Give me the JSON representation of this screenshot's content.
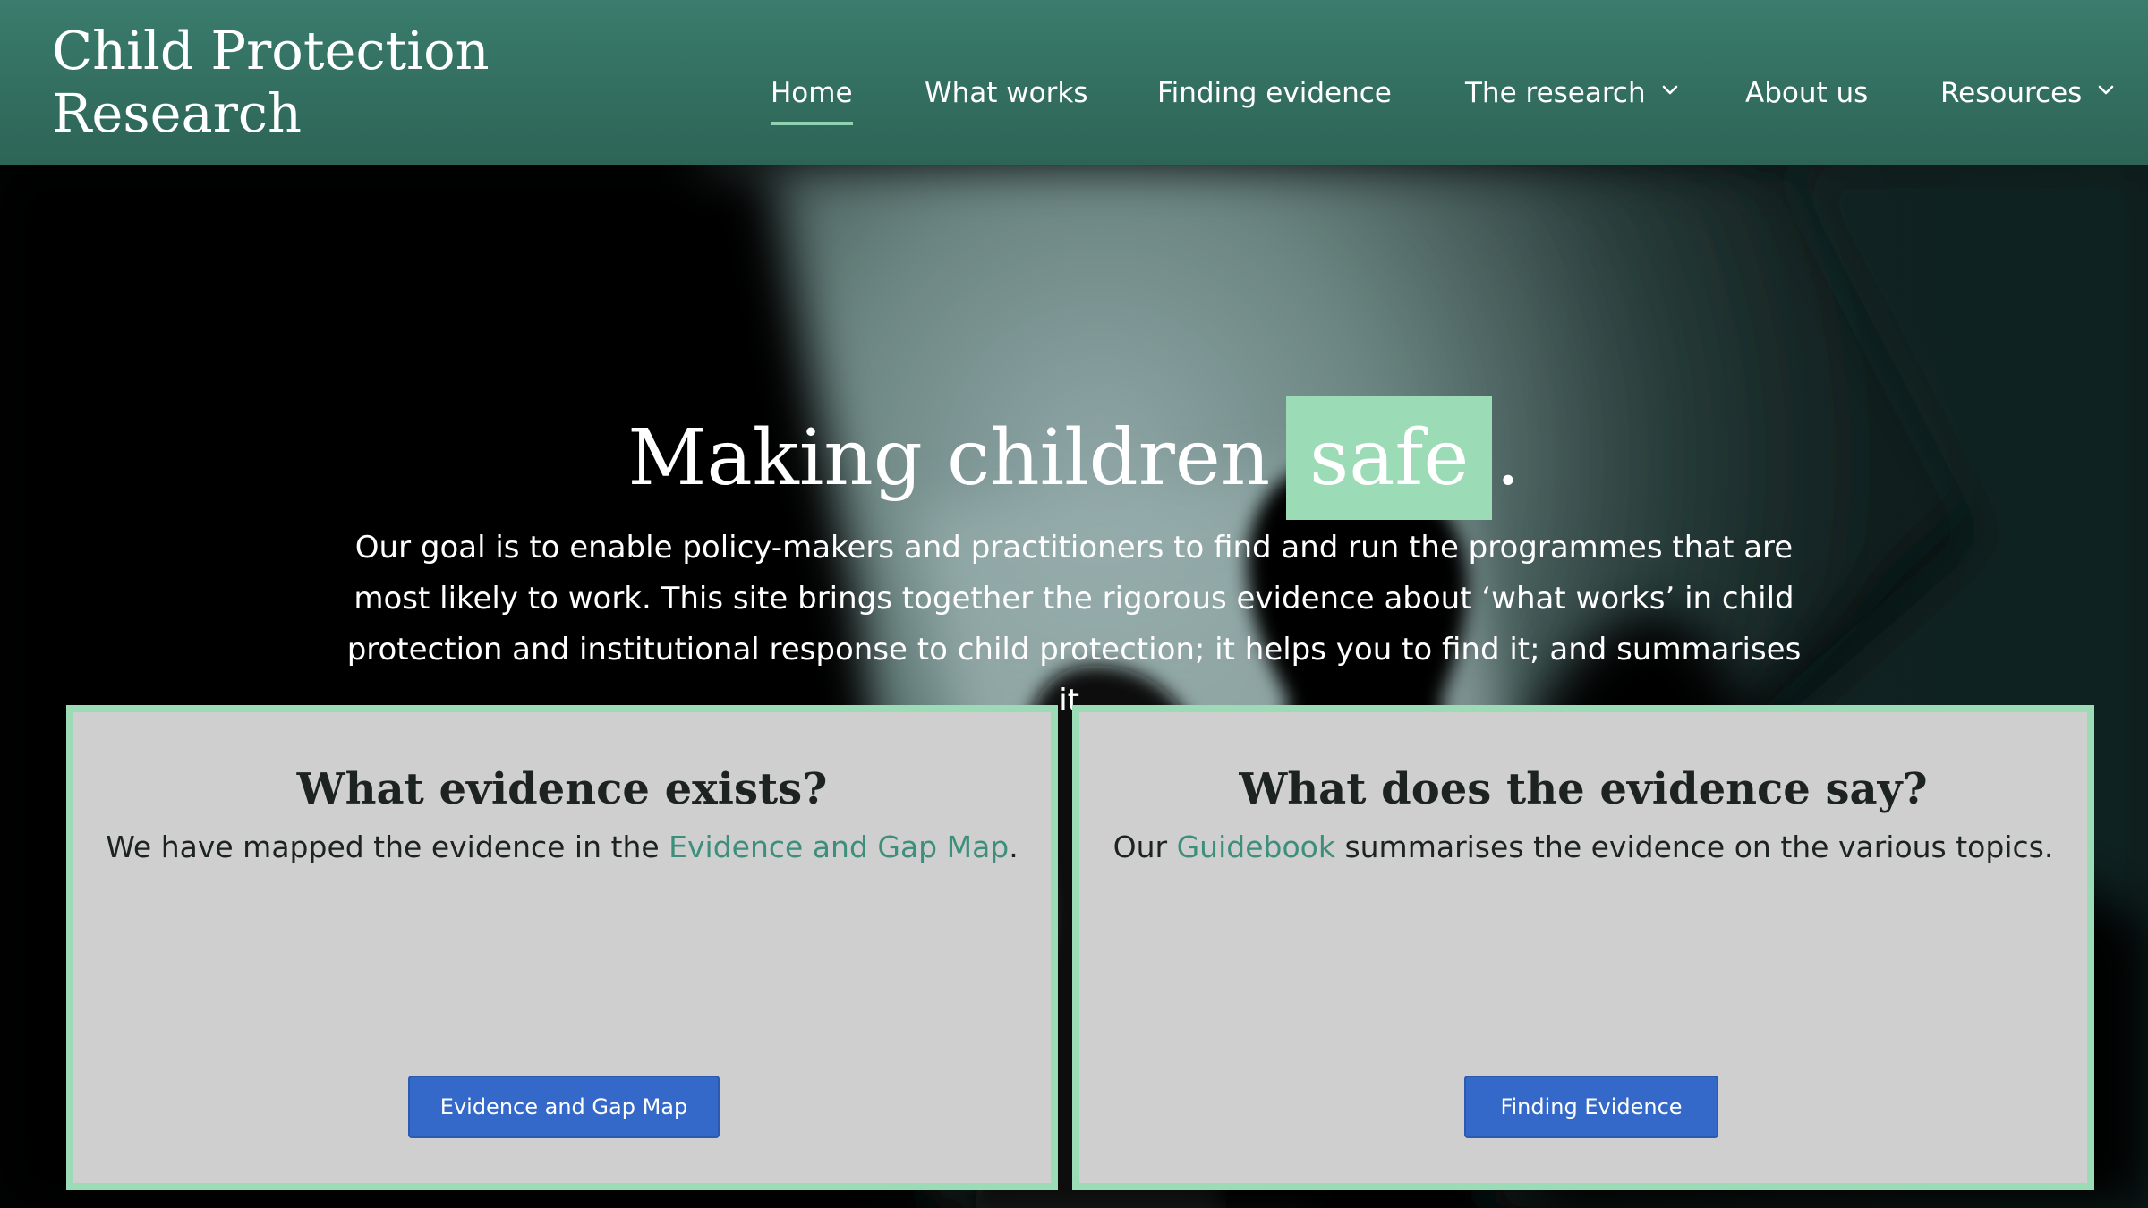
{
  "site": {
    "logo": "Child Protection Research"
  },
  "nav": {
    "items": [
      {
        "label": "Home",
        "active": true,
        "dropdown": false
      },
      {
        "label": "What works",
        "active": false,
        "dropdown": false
      },
      {
        "label": "Finding evidence",
        "active": false,
        "dropdown": false
      },
      {
        "label": "The research",
        "active": false,
        "dropdown": true
      },
      {
        "label": "About us",
        "active": false,
        "dropdown": false
      },
      {
        "label": "Resources",
        "active": false,
        "dropdown": true
      }
    ]
  },
  "hero": {
    "title_before": "Making children",
    "title_highlight": "safe",
    "title_after": ".",
    "description": "Our goal is to enable policy-makers and practitioners to find and run the programmes that are most likely to work. This site brings together the rigorous evidence about ‘what works’ in child protection and institutional response to child protection; it helps you to find it; and summarises it."
  },
  "cards": [
    {
      "title": "What evidence exists?",
      "text_before": "We have mapped the evidence in the ",
      "link_text": "Evidence and Gap Map",
      "text_after": ".",
      "button_label": "Evidence and Gap Map"
    },
    {
      "title": "What does the evidence say?",
      "text_before": "Our ",
      "link_text": "Guidebook",
      "text_after": " summarises the evidence on the various topics.",
      "button_label": "Finding Evidence"
    }
  ],
  "colors": {
    "header": "#357063",
    "accent_green": "#9bdbb5",
    "link_green": "#3e8e7c",
    "button_blue": "#3469c9",
    "card_bg": "#cfcfcf"
  }
}
